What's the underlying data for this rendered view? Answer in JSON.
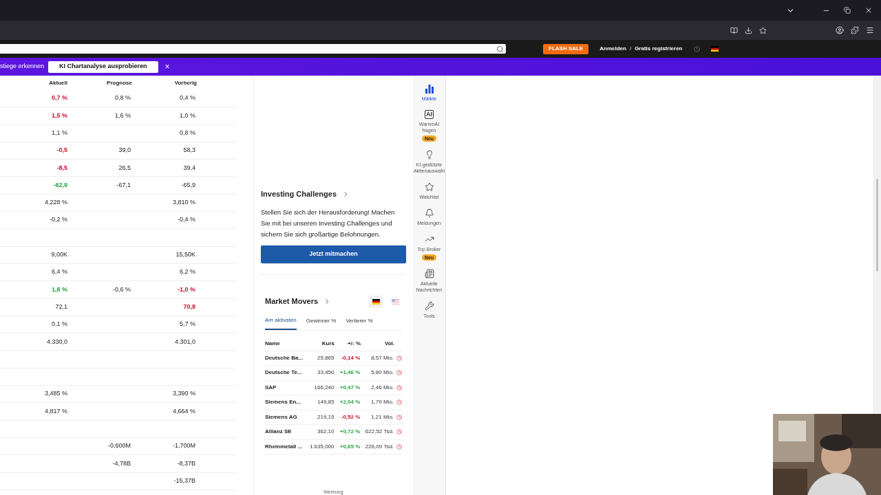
{
  "site_header": {
    "flash_sale": "FLASH SALE",
    "login": "Anmelden",
    "separator": "/",
    "register": "Gratis registrieren"
  },
  "banner": {
    "text": "stiege erkennen",
    "button": "KI Chartanalyse ausprobieren",
    "close": "×"
  },
  "table": {
    "columns": [
      "Aktuell",
      "Prognose",
      "Vorherig"
    ],
    "rows": [
      {
        "kind": "values",
        "aktuell": {
          "text": "0,7 %",
          "color": "#c8102e"
        },
        "prognose": {
          "text": "0,8 %"
        },
        "vorherig": {
          "text": "0,4 %"
        }
      },
      {
        "kind": "values",
        "aktuell": {
          "text": "1,5 %",
          "color": "#c8102e"
        },
        "prognose": {
          "text": "1,6 %"
        },
        "vorherig": {
          "text": "1,0 %"
        }
      },
      {
        "kind": "values",
        "aktuell": {
          "text": "1,1 %"
        },
        "vorherig": {
          "text": "0,8 %"
        }
      },
      {
        "kind": "values",
        "aktuell": {
          "text": "-0,5",
          "color": "#c8102e"
        },
        "prognose": {
          "text": "39,0"
        },
        "vorherig": {
          "text": "58,3"
        }
      },
      {
        "kind": "values",
        "aktuell": {
          "text": "-8,5",
          "color": "#c8102e"
        },
        "prognose": {
          "text": "26,5"
        },
        "vorherig": {
          "text": "39,4"
        }
      },
      {
        "kind": "values",
        "aktuell": {
          "text": "-62,9",
          "color": "#2ea043"
        },
        "prognose": {
          "text": "-67,1"
        },
        "vorherig": {
          "text": "-65,9"
        }
      },
      {
        "kind": "values",
        "aktuell": {
          "text": "4,228 %"
        },
        "vorherig": {
          "text": "3,810 %"
        }
      },
      {
        "kind": "values",
        "aktuell": {
          "text": "-0,2 %"
        },
        "vorherig": {
          "text": "-0,4 %"
        }
      },
      {
        "kind": "blank"
      },
      {
        "kind": "values",
        "aktuell": {
          "text": "9,00K"
        },
        "vorherig": {
          "text": "15,50K"
        }
      },
      {
        "kind": "values",
        "aktuell": {
          "text": "6,4 %"
        },
        "vorherig": {
          "text": "6,2 %"
        }
      },
      {
        "kind": "values",
        "aktuell": {
          "text": "1,8 %",
          "color": "#2ea043"
        },
        "prognose": {
          "text": "-0,6 %"
        },
        "vorherig": {
          "text": "-1,0 %",
          "color": "#c8102e"
        }
      },
      {
        "kind": "values",
        "aktuell": {
          "text": "72,1"
        },
        "vorherig": {
          "text": "70,8",
          "color": "#c8102e"
        }
      },
      {
        "kind": "values",
        "aktuell": {
          "text": "0,1 %"
        },
        "vorherig": {
          "text": "5,7 %"
        }
      },
      {
        "kind": "values",
        "aktuell": {
          "text": "4.330,0"
        },
        "vorherig": {
          "text": "4.301,0"
        }
      },
      {
        "kind": "blank"
      },
      {
        "kind": "blank"
      },
      {
        "kind": "values",
        "aktuell": {
          "text": "3,485 %"
        },
        "vorherig": {
          "text": "3,390 %"
        }
      },
      {
        "kind": "values",
        "aktuell": {
          "text": "4,817 %"
        },
        "vorherig": {
          "text": "4,664 %"
        }
      },
      {
        "kind": "blank"
      },
      {
        "kind": "values",
        "prognose": {
          "text": "-0,600M"
        },
        "vorherig": {
          "text": "-1,700M"
        }
      },
      {
        "kind": "values",
        "prognose": {
          "text": "-4,78B"
        },
        "vorherig": {
          "text": "-8,37B"
        }
      },
      {
        "kind": "values",
        "vorherig": {
          "text": "-15,37B"
        }
      }
    ]
  },
  "investing_challenges": {
    "title": "Investing Challenges",
    "text": "Stellen Sie sich der Herausforderung! Machen Sie mit bei unseren Investing Challenges und sichern Sie sich großartige Belohnungen.",
    "button": "Jetzt mitmachen"
  },
  "market_movers": {
    "title": "Market Movers",
    "markets": [
      {
        "kind": "de",
        "selected": true
      },
      {
        "kind": "us",
        "selected": false
      }
    ],
    "tabs": [
      {
        "label": "Am aktivsten",
        "selected": true
      },
      {
        "label": "Gewinner %",
        "selected": false
      },
      {
        "label": "Verlierer %",
        "selected": false
      }
    ],
    "columns": [
      "Name",
      "Kurs",
      "+/- %",
      "Vol."
    ],
    "rows": [
      {
        "name": "Deutsche Ba...",
        "kurs": "25,865",
        "change": "-0,14 %",
        "color": "#c8102e",
        "vol": "8,57 Mio."
      },
      {
        "name": "Deutsche Te...",
        "kurs": "33,450",
        "change": "+1,46 %",
        "color": "#2ea043",
        "vol": "5,80 Mio."
      },
      {
        "name": "SAP",
        "kurs": "166,240",
        "change": "+0,47 %",
        "color": "#2ea043",
        "vol": "2,46 Mio."
      },
      {
        "name": "Siemens En...",
        "kurs": "149,85",
        "change": "+2,04 %",
        "color": "#2ea043",
        "vol": "1,79 Mio."
      },
      {
        "name": "Siemens AG",
        "kurs": "219,15",
        "change": "-0,52 %",
        "color": "#c8102e",
        "vol": "1,21 Mio."
      },
      {
        "name": "Allianz SE",
        "kurs": "362,10",
        "change": "+0,72 %",
        "color": "#2ea043",
        "vol": "622,52 Tsd."
      },
      {
        "name": "Rheinmetall ...",
        "kurs": "1.635,000",
        "change": "+0,65 %",
        "color": "#2ea043",
        "vol": "226,09 Tsd."
      }
    ],
    "footer": "Werbung"
  },
  "sidebar": {
    "items": [
      {
        "kind": "chart",
        "label": "Märkte",
        "selected": true
      },
      {
        "kind": "ai",
        "icon_text": "AI",
        "label": "WarrenAI fragen",
        "badge": "Neu",
        "selected": false
      },
      {
        "kind": "bulb",
        "label": "KI-gestützte Aktienauswahl",
        "selected": false
      },
      {
        "kind": "star",
        "label": "Watchlist",
        "selected": false
      },
      {
        "kind": "bell",
        "label": "Meldungen",
        "selected": false
      },
      {
        "kind": "trend",
        "label": "Top Broker",
        "badge": "Neu",
        "selected": false
      },
      {
        "kind": "news",
        "label": "Aktuelle Nachrichten",
        "selected": false
      },
      {
        "kind": "tools",
        "label": "Tools",
        "selected": false
      }
    ]
  }
}
